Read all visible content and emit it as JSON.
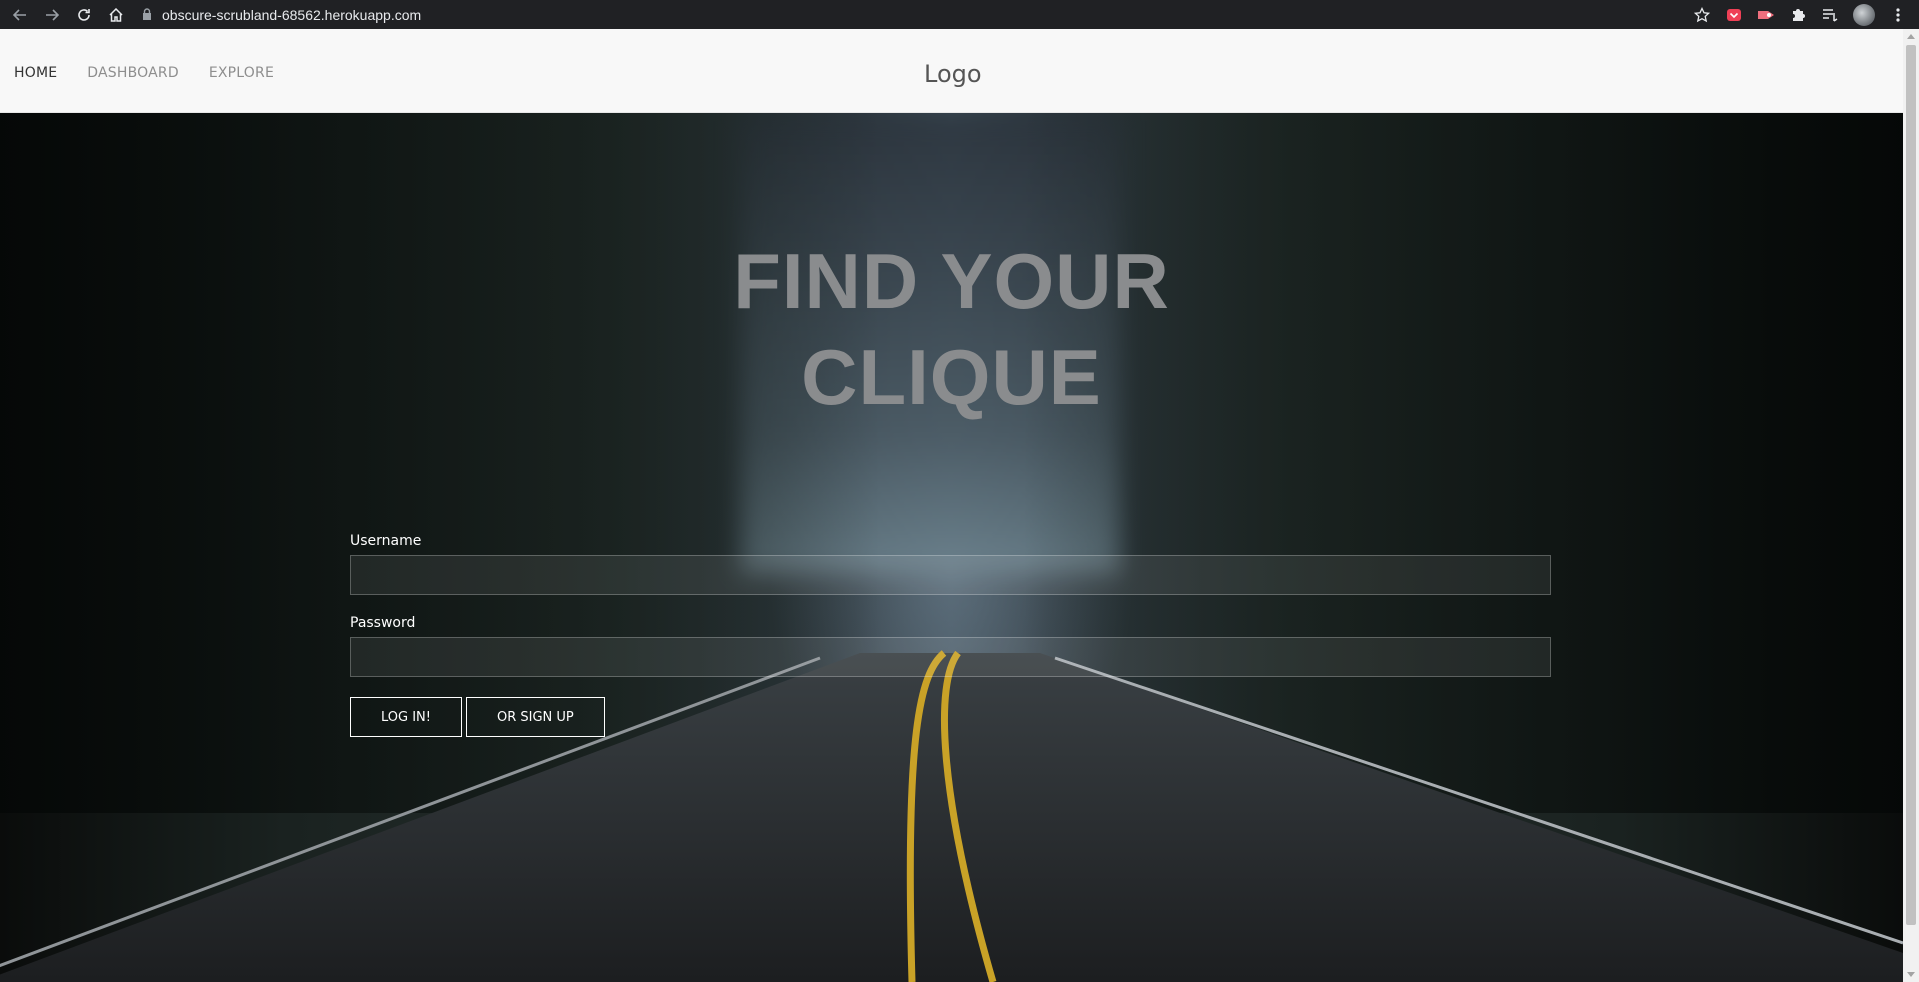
{
  "browser": {
    "url": "obscure-scrubland-68562.herokuapp.com",
    "icons": [
      "back-icon",
      "forward-icon",
      "reload-icon",
      "home-icon",
      "lock-icon",
      "star-icon",
      "pocket-icon",
      "cast-icon",
      "extensions-icon",
      "reading-list-icon",
      "profile-avatar",
      "menu-icon"
    ]
  },
  "navbar": {
    "links": [
      {
        "label": "HOME",
        "current": true
      },
      {
        "label": "DASHBOARD",
        "current": false
      },
      {
        "label": "EXPLORE",
        "current": false
      }
    ],
    "logo": "Logo"
  },
  "hero": {
    "title_line1": "FIND YOUR",
    "title_line2": "CLIQUE"
  },
  "login_form": {
    "username_label": "Username",
    "username_value": "",
    "password_label": "Password",
    "password_value": "",
    "login_button": "LOG IN!",
    "signup_button": "OR SIGN UP"
  },
  "colors": {
    "navbar_bg": "#f8f8f8",
    "title": "#8a8c8e",
    "road_line": "#c9a227"
  }
}
